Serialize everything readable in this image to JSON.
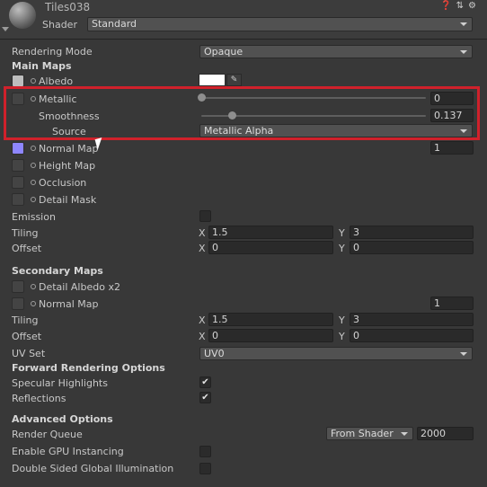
{
  "header": {
    "material_name": "Tiles038",
    "shader_label": "Shader",
    "shader_value": "Standard",
    "icons": [
      "help-icon",
      "preset-icon",
      "settings-icon"
    ]
  },
  "rendering_mode": {
    "label": "Rendering Mode",
    "value": "Opaque"
  },
  "main_maps": {
    "title": "Main Maps",
    "albedo_label": "Albedo",
    "albedo_color": "#ffffff",
    "metallic": {
      "label": "Metallic",
      "value": "0",
      "fraction": 0.0
    },
    "smoothness": {
      "label": "Smoothness",
      "value": "0.137",
      "fraction": 0.137
    },
    "source": {
      "label": "Source",
      "value": "Metallic Alpha"
    },
    "normal_map": {
      "label": "Normal Map",
      "value": "1",
      "color": "#8e86ff"
    },
    "height_map": "Height Map",
    "occlusion": "Occlusion",
    "detail_mask": "Detail Mask",
    "emission": "Emission",
    "tiling": {
      "label": "Tiling",
      "x_label": "X",
      "x": "1.5",
      "y_label": "Y",
      "y": "3"
    },
    "offset": {
      "label": "Offset",
      "x_label": "X",
      "x": "0",
      "y_label": "Y",
      "y": "0"
    }
  },
  "secondary_maps": {
    "title": "Secondary Maps",
    "detail_albedo": "Detail Albedo x2",
    "normal_map": {
      "label": "Normal Map",
      "value": "1"
    },
    "tiling": {
      "label": "Tiling",
      "x_label": "X",
      "x": "1.5",
      "y_label": "Y",
      "y": "3"
    },
    "offset": {
      "label": "Offset",
      "x_label": "X",
      "x": "0",
      "y_label": "Y",
      "y": "0"
    },
    "uv_set": {
      "label": "UV Set",
      "value": "UV0"
    }
  },
  "forward_rendering": {
    "title": "Forward Rendering Options",
    "specular_highlights": {
      "label": "Specular Highlights",
      "checked": true
    },
    "reflections": {
      "label": "Reflections",
      "checked": true
    }
  },
  "advanced": {
    "title": "Advanced Options",
    "render_queue": {
      "label": "Render Queue",
      "source": "From Shader",
      "value": "2000"
    },
    "gpu_instancing": {
      "label": "Enable GPU Instancing",
      "checked": false
    },
    "double_sided_gi": {
      "label": "Double Sided Global Illumination",
      "checked": false
    }
  },
  "check_mark": "✔",
  "highlight_color": "#d0212b"
}
